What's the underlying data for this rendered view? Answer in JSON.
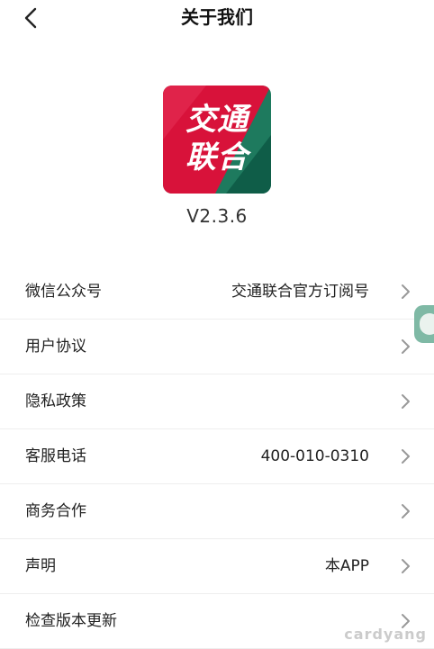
{
  "header": {
    "title": "关于我们",
    "back_icon": "chevron-left-icon"
  },
  "app": {
    "logo_line1": "交通",
    "logo_line2": "联合",
    "version": "V2.3.6",
    "logo_colors": {
      "red": "#d8123a",
      "green": "#1e7a5e",
      "dark_green": "#0f5d48"
    }
  },
  "list": {
    "items": [
      {
        "label": "微信公众号",
        "value": "交通联合官方订阅号"
      },
      {
        "label": "用户协议",
        "value": ""
      },
      {
        "label": "隐私政策",
        "value": ""
      },
      {
        "label": "客服电话",
        "value": "400-010-0310"
      },
      {
        "label": "商务合作",
        "value": ""
      },
      {
        "label": "声明",
        "value": "本APP"
      },
      {
        "label": "检查版本更新",
        "value": ""
      }
    ],
    "chevron_icon": "chevron-right-icon"
  },
  "watermark": "cardyang"
}
